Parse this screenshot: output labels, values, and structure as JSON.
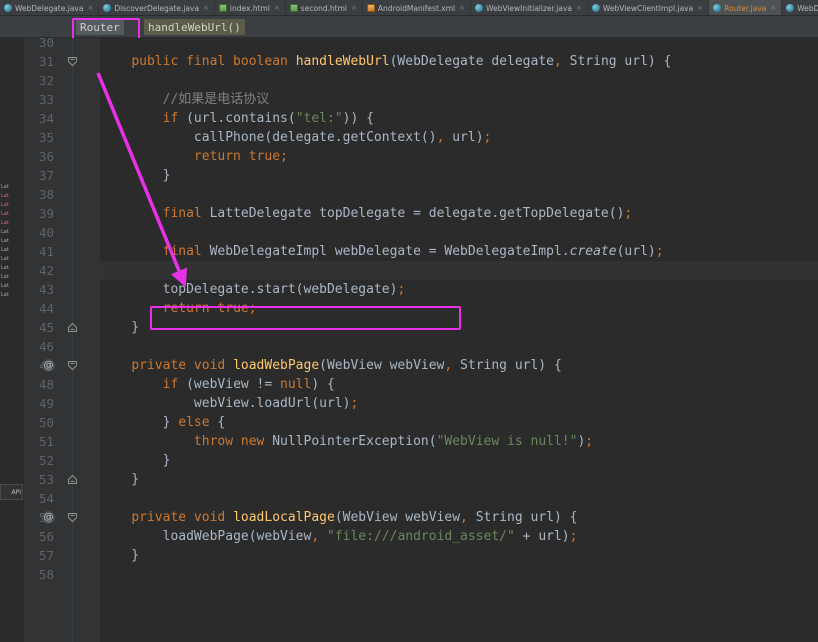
{
  "window": {
    "theme": "darcula",
    "accent_annotation_color": "#e830e8"
  },
  "tabs": [
    {
      "label": "WebDelegate.java",
      "icon": "java-class-icon",
      "active": false,
      "close": "×"
    },
    {
      "label": "DiscoverDelegate.java",
      "icon": "java-class-icon",
      "active": false,
      "close": "×"
    },
    {
      "label": "index.html",
      "icon": "html-file-icon",
      "active": false,
      "close": "×"
    },
    {
      "label": "second.html",
      "icon": "html-file-icon",
      "active": false,
      "close": "×"
    },
    {
      "label": "AndroidManifest.xml",
      "icon": "xml-file-icon",
      "active": false,
      "close": "×"
    },
    {
      "label": "WebViewInitializer.java",
      "icon": "java-class-icon",
      "active": false,
      "close": "×"
    },
    {
      "label": "WebViewClientImpl.java",
      "icon": "java-class-icon",
      "active": false,
      "close": "×"
    },
    {
      "label": "Router.java",
      "icon": "java-class-icon",
      "active": true,
      "close": "×"
    },
    {
      "label": "WebDelegateImpl.java",
      "icon": "java-class-icon",
      "active": false,
      "close": "×"
    }
  ],
  "breadcrumb": {
    "class": "Router",
    "method": "handleWebUrl()"
  },
  "left_panel": {
    "api_label": "API",
    "chips": [
      "Lat",
      "Lat",
      "Lat",
      "Lat",
      "Lat",
      "Lat",
      "Lat",
      "Lat",
      "Lat",
      "Lat",
      "Lat",
      "Lat",
      "Lat"
    ]
  },
  "gutter": {
    "first_line": 30,
    "last_line": 58,
    "annotation_marker": "@",
    "annotated_lines": [
      47,
      55
    ]
  },
  "editor": {
    "caret_line": 42,
    "highlighted_line": 42,
    "lines": [
      {
        "n": 30,
        "tokens": []
      },
      {
        "n": 31,
        "tokens": [
          {
            "t": "    ",
            "c": "pun"
          },
          {
            "t": "public final boolean ",
            "c": "kw"
          },
          {
            "t": "handleWebUrl",
            "c": "mth"
          },
          {
            "t": "(WebDelegate delegate",
            "c": "cls"
          },
          {
            "t": ",",
            "c": "semi"
          },
          {
            "t": " String url) {",
            "c": "cls"
          }
        ]
      },
      {
        "n": 32,
        "tokens": []
      },
      {
        "n": 33,
        "tokens": [
          {
            "t": "        ",
            "c": "pun"
          },
          {
            "t": "//如果是电话协议",
            "c": "cmt"
          }
        ]
      },
      {
        "n": 34,
        "tokens": [
          {
            "t": "        ",
            "c": "pun"
          },
          {
            "t": "if",
            "c": "kw"
          },
          {
            "t": " (url.contains(",
            "c": "cls"
          },
          {
            "t": "\"tel:\"",
            "c": "str"
          },
          {
            "t": ")) {",
            "c": "cls"
          }
        ]
      },
      {
        "n": 35,
        "tokens": [
          {
            "t": "            ",
            "c": "pun"
          },
          {
            "t": "callPhone(delegate.getContext()",
            "c": "cls"
          },
          {
            "t": ",",
            "c": "semi"
          },
          {
            "t": " url)",
            "c": "cls"
          },
          {
            "t": ";",
            "c": "semi"
          }
        ]
      },
      {
        "n": 36,
        "tokens": [
          {
            "t": "            ",
            "c": "pun"
          },
          {
            "t": "return true",
            "c": "kw"
          },
          {
            "t": ";",
            "c": "semi"
          }
        ]
      },
      {
        "n": 37,
        "tokens": [
          {
            "t": "        }",
            "c": "pun"
          }
        ]
      },
      {
        "n": 38,
        "tokens": []
      },
      {
        "n": 39,
        "tokens": [
          {
            "t": "        ",
            "c": "pun"
          },
          {
            "t": "final",
            "c": "kw"
          },
          {
            "t": " LatteDelegate topDelegate = delegate.getTopDelegate()",
            "c": "cls"
          },
          {
            "t": ";",
            "c": "semi"
          }
        ]
      },
      {
        "n": 40,
        "tokens": []
      },
      {
        "n": 41,
        "tokens": [
          {
            "t": "        ",
            "c": "pun"
          },
          {
            "t": "final",
            "c": "kw"
          },
          {
            "t": " WebDelegateImpl webDelegate = WebDelegateImpl.",
            "c": "cls"
          },
          {
            "t": "create",
            "c": "stat"
          },
          {
            "t": "(url)",
            "c": "cls"
          },
          {
            "t": ";",
            "c": "semi"
          }
        ]
      },
      {
        "n": 42,
        "tokens": []
      },
      {
        "n": 43,
        "tokens": [
          {
            "t": "        ",
            "c": "pun"
          },
          {
            "t": "topDelegate.start(webDelegate)",
            "c": "cls"
          },
          {
            "t": ";",
            "c": "semi"
          }
        ]
      },
      {
        "n": 44,
        "tokens": [
          {
            "t": "        ",
            "c": "pun"
          },
          {
            "t": "return true",
            "c": "kw"
          },
          {
            "t": ";",
            "c": "semi"
          }
        ]
      },
      {
        "n": 45,
        "tokens": [
          {
            "t": "    }",
            "c": "pun"
          }
        ]
      },
      {
        "n": 46,
        "tokens": []
      },
      {
        "n": 47,
        "tokens": [
          {
            "t": "    ",
            "c": "pun"
          },
          {
            "t": "private void ",
            "c": "kw"
          },
          {
            "t": "loadWebPage",
            "c": "mth"
          },
          {
            "t": "(WebView webView",
            "c": "cls"
          },
          {
            "t": ",",
            "c": "semi"
          },
          {
            "t": " String url) {",
            "c": "cls"
          }
        ]
      },
      {
        "n": 48,
        "tokens": [
          {
            "t": "        ",
            "c": "pun"
          },
          {
            "t": "if",
            "c": "kw"
          },
          {
            "t": " (webView != ",
            "c": "cls"
          },
          {
            "t": "null",
            "c": "kw"
          },
          {
            "t": ") {",
            "c": "cls"
          }
        ]
      },
      {
        "n": 49,
        "tokens": [
          {
            "t": "            ",
            "c": "pun"
          },
          {
            "t": "webView.loadUrl(url)",
            "c": "cls"
          },
          {
            "t": ";",
            "c": "semi"
          }
        ]
      },
      {
        "n": 50,
        "tokens": [
          {
            "t": "        } ",
            "c": "pun"
          },
          {
            "t": "else",
            "c": "kw"
          },
          {
            "t": " {",
            "c": "cls"
          }
        ]
      },
      {
        "n": 51,
        "tokens": [
          {
            "t": "            ",
            "c": "pun"
          },
          {
            "t": "throw new ",
            "c": "kw"
          },
          {
            "t": "NullPointerException(",
            "c": "cls"
          },
          {
            "t": "\"WebView is null!\"",
            "c": "str"
          },
          {
            "t": ")",
            "c": "cls"
          },
          {
            "t": ";",
            "c": "semi"
          }
        ]
      },
      {
        "n": 52,
        "tokens": [
          {
            "t": "        }",
            "c": "pun"
          }
        ]
      },
      {
        "n": 53,
        "tokens": [
          {
            "t": "    }",
            "c": "pun"
          }
        ]
      },
      {
        "n": 54,
        "tokens": []
      },
      {
        "n": 55,
        "tokens": [
          {
            "t": "    ",
            "c": "pun"
          },
          {
            "t": "private void ",
            "c": "kw"
          },
          {
            "t": "loadLocalPage",
            "c": "mth"
          },
          {
            "t": "(WebView webView",
            "c": "cls"
          },
          {
            "t": ",",
            "c": "semi"
          },
          {
            "t": " String url) {",
            "c": "cls"
          }
        ]
      },
      {
        "n": 56,
        "tokens": [
          {
            "t": "        ",
            "c": "pun"
          },
          {
            "t": "loadWebPage(webView",
            "c": "cls"
          },
          {
            "t": ",",
            "c": "semi"
          },
          {
            "t": " ",
            "c": "cls"
          },
          {
            "t": "\"file:///android_asset/\"",
            "c": "str"
          },
          {
            "t": " + url)",
            "c": "cls"
          },
          {
            "t": ";",
            "c": "semi"
          }
        ]
      },
      {
        "n": 57,
        "tokens": [
          {
            "t": "    }",
            "c": "pun"
          }
        ]
      },
      {
        "n": 58,
        "tokens": []
      }
    ]
  },
  "annotations": {
    "class_crumb_box": "Router",
    "statement_box": "topDelegate.start(webDelegate);",
    "arrow": "points from Router breadcrumb to line 41 final WebDelegateImpl"
  }
}
